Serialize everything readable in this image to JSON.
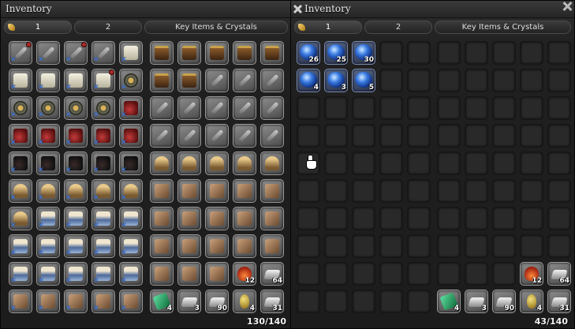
{
  "left_window": {
    "title": "Inventory",
    "tabs": [
      {
        "label": "1",
        "active": true
      },
      {
        "label": "2",
        "active": false
      },
      {
        "label": "Key Items & Crystals",
        "active": false
      }
    ],
    "capacity": "130/140"
  },
  "right_window": {
    "title": "Inventory",
    "tabs": [
      {
        "label": "1",
        "active": true
      },
      {
        "label": "2",
        "active": false
      },
      {
        "label": "Key Items & Crystals",
        "active": false
      }
    ],
    "capacity": "43/140"
  },
  "left_item_quantities": {
    "potion": "12",
    "ingot_top": "64",
    "green": "4",
    "ingot_a": "3",
    "ingot_b": "90",
    "egg": "4",
    "ingot_c": "31"
  },
  "crystals": [
    {
      "count": "26"
    },
    {
      "count": "25"
    },
    {
      "count": "30"
    },
    {
      "count": "4"
    },
    {
      "count": "3"
    },
    {
      "count": "5"
    }
  ],
  "right_item_quantities": {
    "potion": "12",
    "ingot_top": "64",
    "green": "4",
    "ingot_a": "3",
    "ingot_b": "90",
    "egg": "4",
    "ingot_c": "31"
  }
}
